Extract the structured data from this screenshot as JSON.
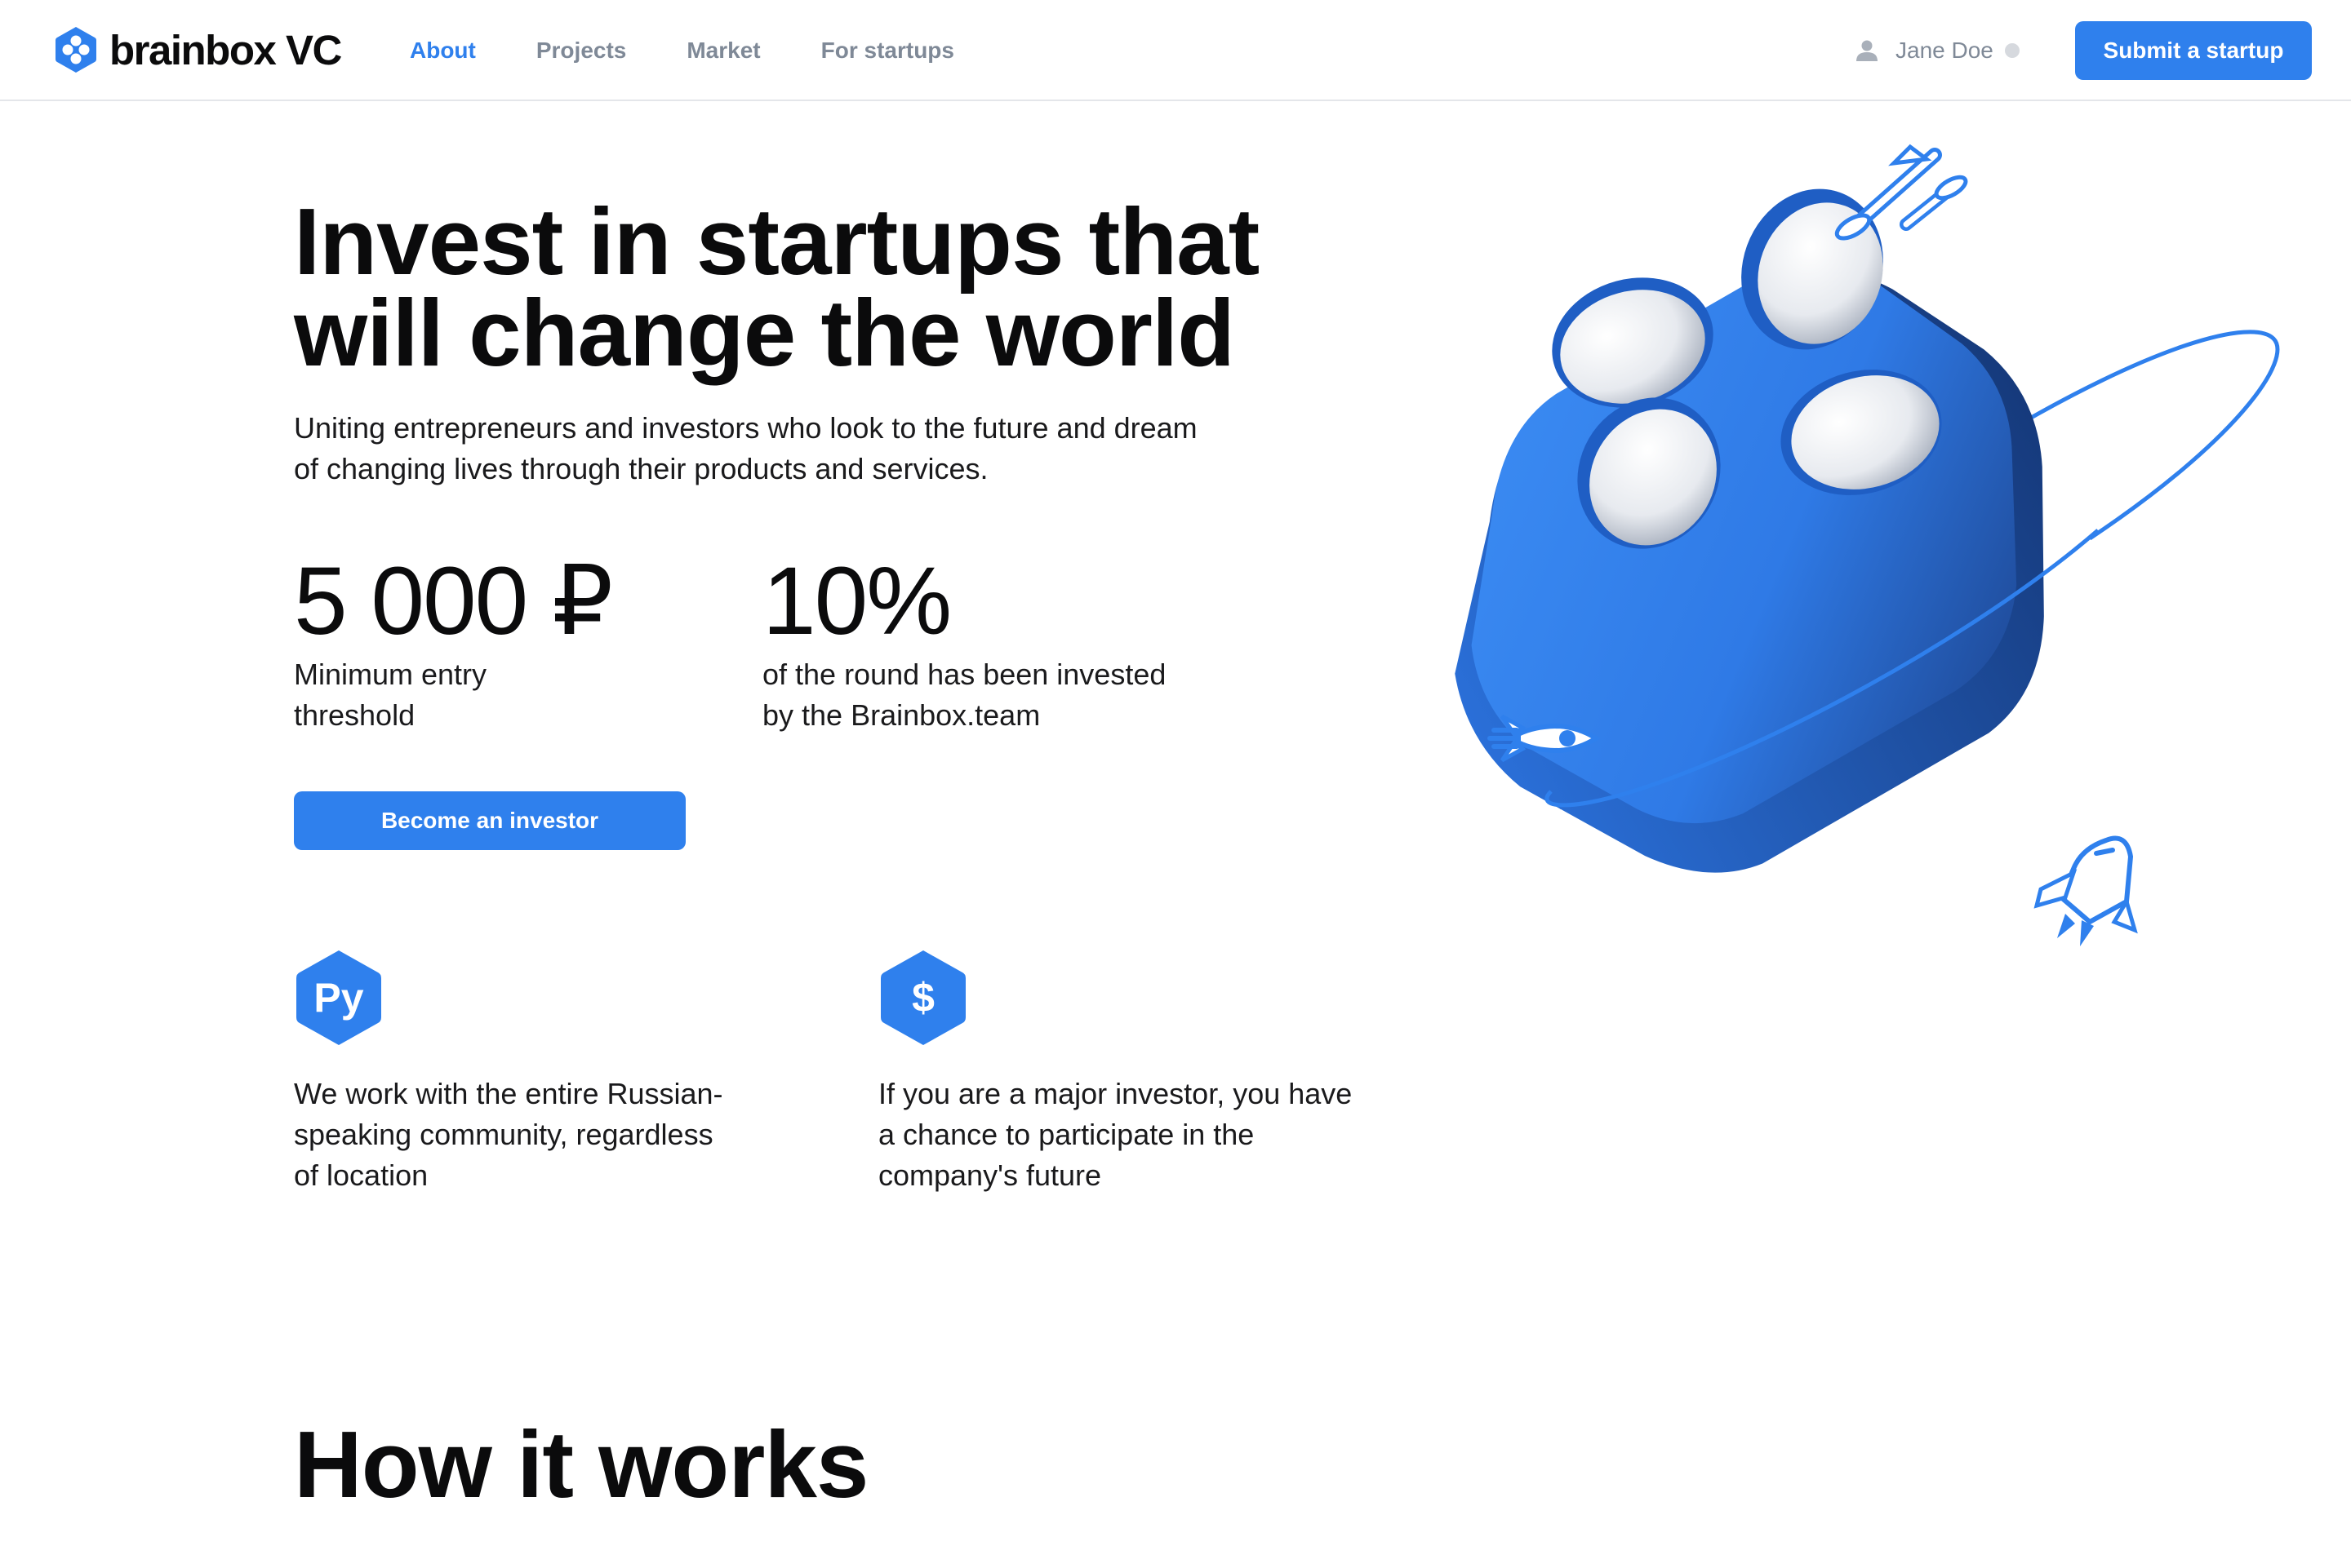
{
  "brand": {
    "name": "brainbox VC"
  },
  "nav": {
    "items": [
      {
        "label": "About",
        "active": true
      },
      {
        "label": "Projects",
        "active": false
      },
      {
        "label": "Market",
        "active": false
      },
      {
        "label": "For startups",
        "active": false
      }
    ]
  },
  "user": {
    "name": "Jane Doe",
    "icon": "user-icon"
  },
  "header": {
    "submit_label": "Submit a startup"
  },
  "hero": {
    "title_line1": "Invest in startups that",
    "title_line2": "will change the world",
    "subtitle_line1": "Uniting entrepreneurs and investors who look to the future and dream",
    "subtitle_line2": "of changing lives through their products and services.",
    "stats": [
      {
        "value": "5 000 ₽",
        "label_line1": "Minimum entry",
        "label_line2": "threshold"
      },
      {
        "value": "10%",
        "label_line1": "of the round has been invested",
        "label_line2": "by the Brainbox.team"
      }
    ],
    "cta_label": "Become an investor"
  },
  "features": [
    {
      "icon": "py",
      "line1": "We work with the entire Russian-",
      "line2": "speaking community, regardless",
      "line3": "of location"
    },
    {
      "icon": "$",
      "line1": "If you are a major investor, you have",
      "line2": "a chance to participate in the",
      "line3": "company's future"
    }
  ],
  "section": {
    "title": "How it works"
  },
  "colors": {
    "accent": "#2f80ed",
    "text": "#0b0b0c",
    "muted": "#7f8997",
    "border": "#e4e6ea"
  }
}
